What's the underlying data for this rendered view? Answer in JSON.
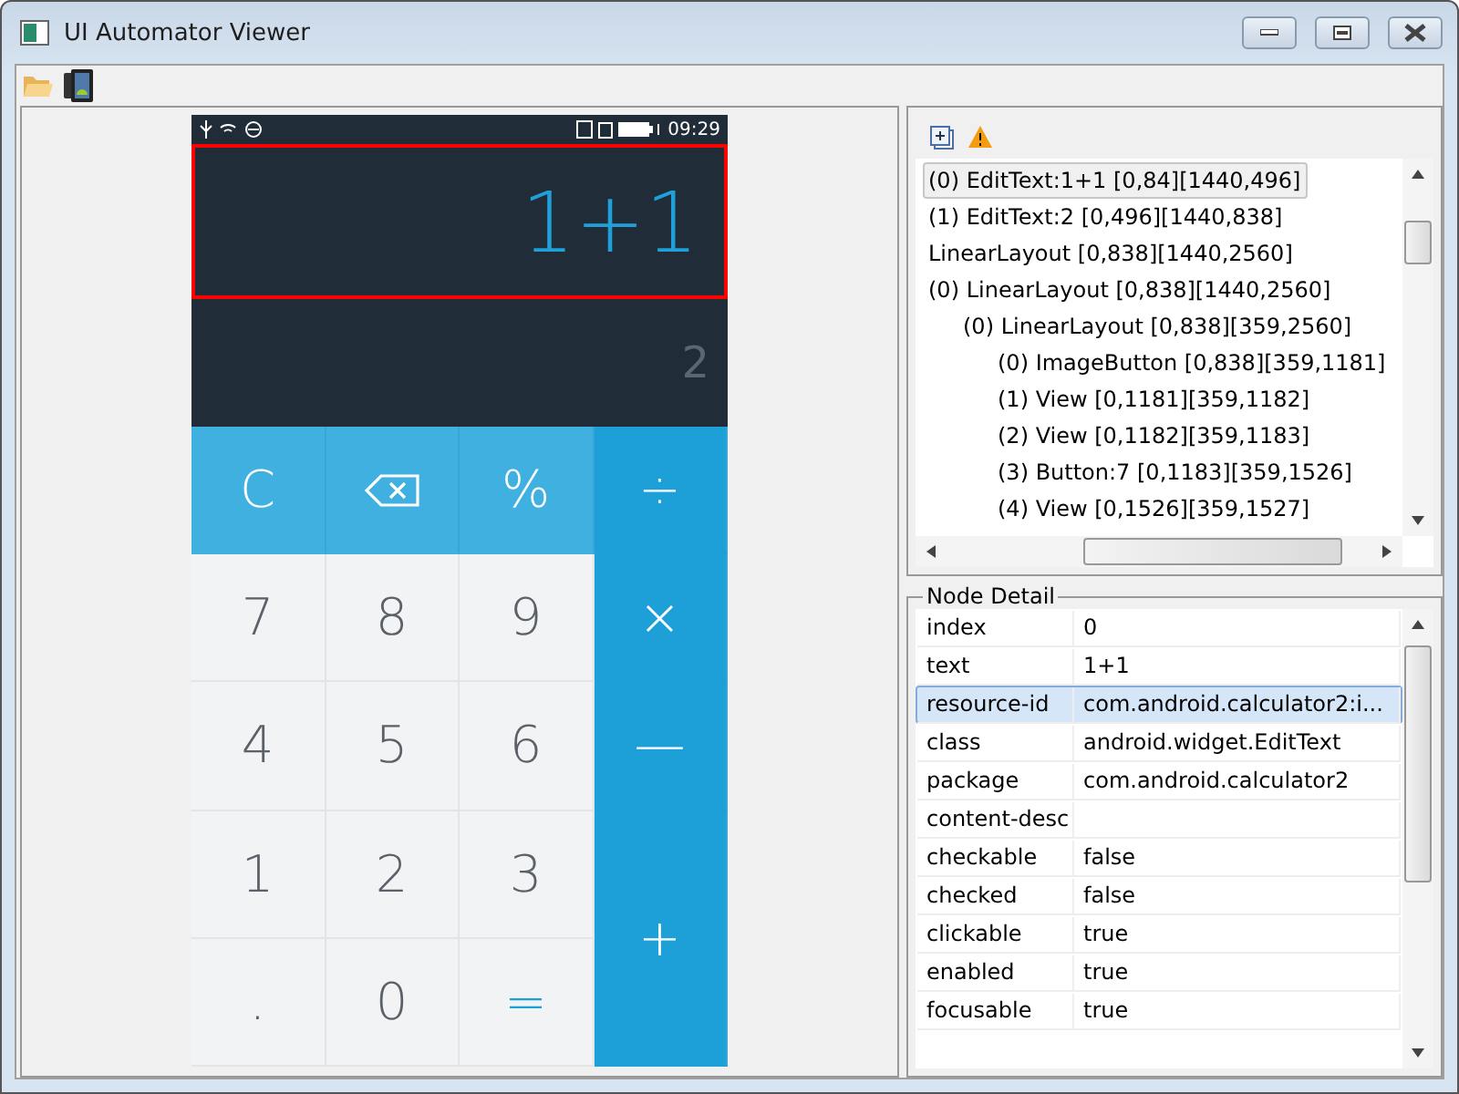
{
  "window": {
    "title": "UI Automator Viewer"
  },
  "device": {
    "status_time": "09:29",
    "expression": "1+1",
    "result": "2",
    "expression_highlighted": true,
    "keys": [
      {
        "kind": "func",
        "label": "C"
      },
      {
        "kind": "backspace"
      },
      {
        "kind": "func",
        "label": "%"
      },
      {
        "kind": "op",
        "label": "÷"
      },
      {
        "kind": "digit",
        "label": "7"
      },
      {
        "kind": "digit",
        "label": "8"
      },
      {
        "kind": "digit",
        "label": "9"
      },
      {
        "kind": "op",
        "label": "×"
      },
      {
        "kind": "digit",
        "label": "4"
      },
      {
        "kind": "digit",
        "label": "5"
      },
      {
        "kind": "digit",
        "label": "6"
      },
      {
        "kind": "op",
        "label": "—"
      },
      {
        "kind": "digit",
        "label": "1"
      },
      {
        "kind": "digit",
        "label": "2"
      },
      {
        "kind": "digit",
        "label": "3"
      },
      {
        "kind": "op-tall",
        "label": "+"
      },
      {
        "kind": "digit",
        "label": "."
      },
      {
        "kind": "digit",
        "label": "0"
      },
      {
        "kind": "equals",
        "label": "="
      }
    ]
  },
  "tree": [
    {
      "label": "(0) EditText:1+1 [0,84][1440,496]",
      "selected": true
    },
    {
      "label": "(1) EditText:2 [0,496][1440,838]",
      "selected": false
    },
    {
      "label": "LinearLayout [0,838][1440,2560]",
      "selected": false
    },
    {
      "label": "(0) LinearLayout [0,838][1440,2560]",
      "selected": false,
      "children": [
        {
          "label": "(0) LinearLayout [0,838][359,2560]",
          "selected": false,
          "children": [
            {
              "label": "(0) ImageButton [0,838][359,1181]",
              "selected": false
            },
            {
              "label": "(1) View [0,1181][359,1182]",
              "selected": false
            },
            {
              "label": "(2) View [0,1182][359,1183]",
              "selected": false
            },
            {
              "label": "(3) Button:7 [0,1183][359,1526]",
              "selected": false
            },
            {
              "label": "(4) View [0,1526][359,1527]",
              "selected": false
            }
          ]
        }
      ]
    }
  ],
  "node_detail": {
    "title": "Node Detail",
    "rows": [
      {
        "property": "index",
        "value": "0",
        "selected": false
      },
      {
        "property": "text",
        "value": "1+1",
        "selected": false
      },
      {
        "property": "resource-id",
        "value": "com.android.calculator2:i...",
        "selected": true
      },
      {
        "property": "class",
        "value": "android.widget.EditText",
        "selected": false
      },
      {
        "property": "package",
        "value": "com.android.calculator2",
        "selected": false
      },
      {
        "property": "content-desc",
        "selected": false
      },
      {
        "property": "checkable",
        "value": "false",
        "selected": false
      },
      {
        "property": "checked",
        "value": "false",
        "selected": false
      },
      {
        "property": "clickable",
        "value": "true",
        "selected": false
      },
      {
        "property": "enabled",
        "value": "true",
        "selected": false
      },
      {
        "property": "focusable",
        "value": "true",
        "selected": false
      }
    ]
  }
}
